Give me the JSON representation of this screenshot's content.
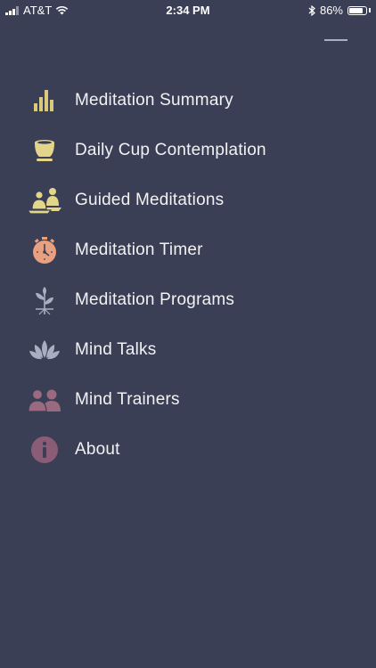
{
  "status_bar": {
    "carrier": "AT&T",
    "time": "2:34 PM",
    "battery_percent": "86%",
    "battery_level": 0.86
  },
  "menu": {
    "items": [
      {
        "label": "Meditation Summary",
        "icon": "bar-chart-icon",
        "color": "#d9c97a"
      },
      {
        "label": "Daily Cup Contemplation",
        "icon": "cup-icon",
        "color": "#e3d68a"
      },
      {
        "label": "Guided Meditations",
        "icon": "meditating-people-icon",
        "color": "#e3d68a"
      },
      {
        "label": "Meditation Timer",
        "icon": "stopwatch-icon",
        "color": "#e8a07e"
      },
      {
        "label": "Meditation Programs",
        "icon": "sprout-icon",
        "color": "#a9aec2"
      },
      {
        "label": "Mind Talks",
        "icon": "lotus-icon",
        "color": "#a9aec2"
      },
      {
        "label": "Mind Trainers",
        "icon": "people-icon",
        "color": "#9a6a80"
      },
      {
        "label": "About",
        "icon": "info-icon",
        "color": "#8a5c75"
      }
    ]
  }
}
